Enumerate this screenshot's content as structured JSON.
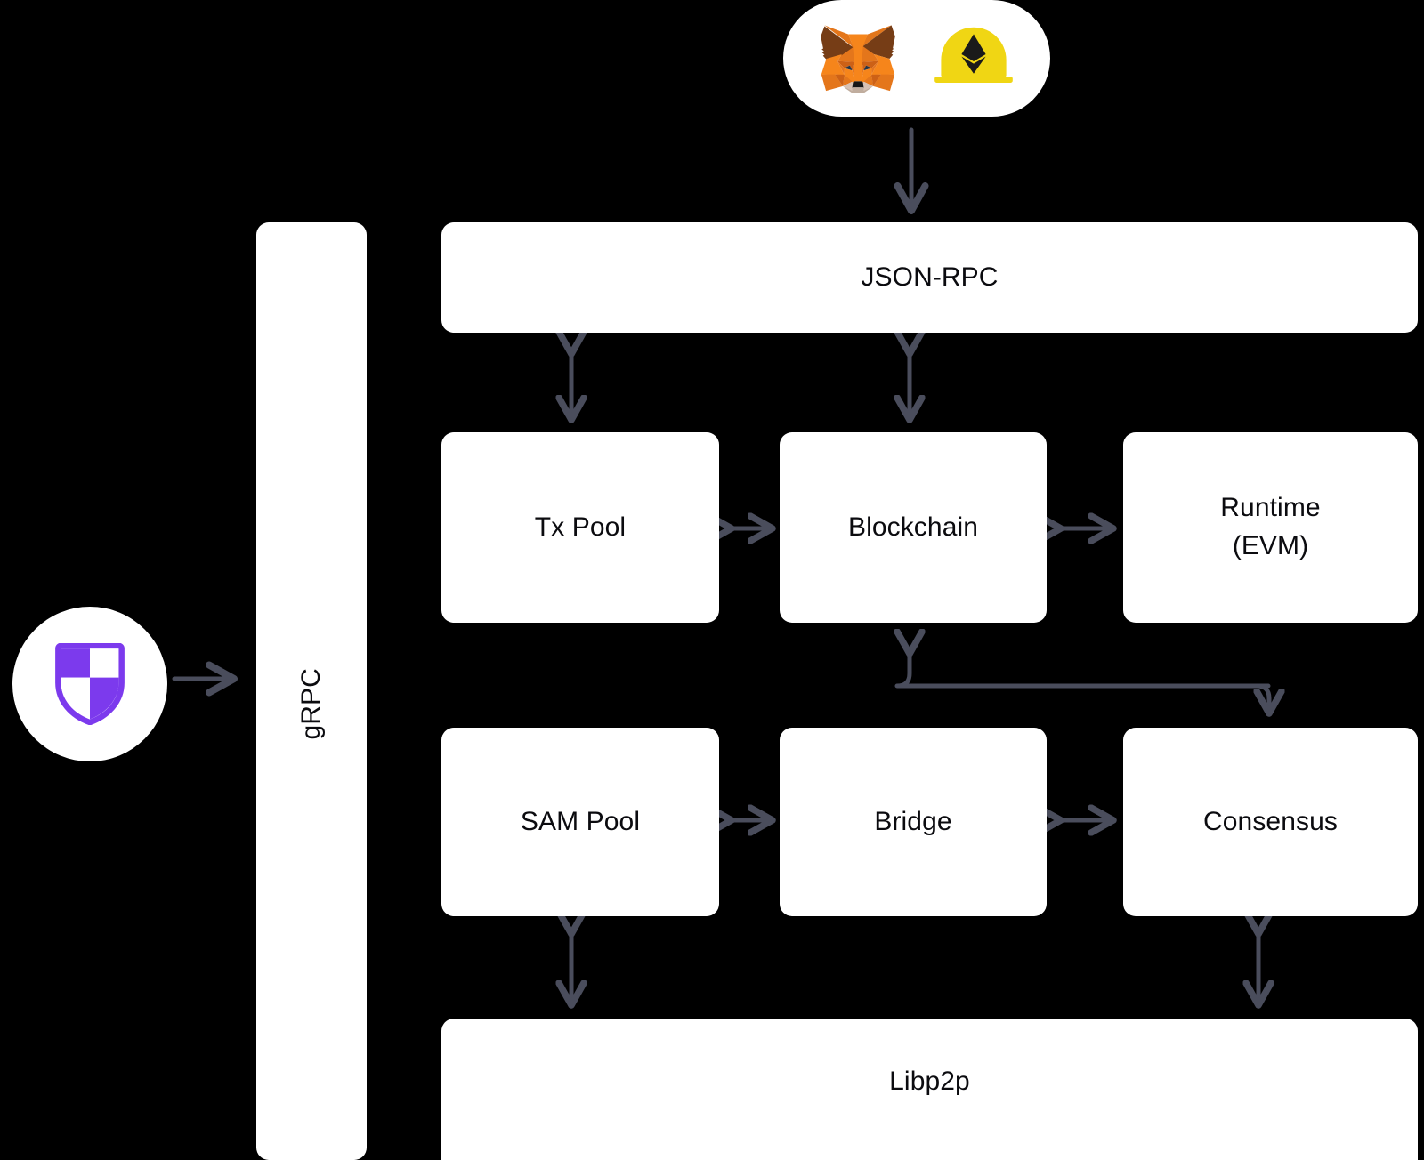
{
  "diagram": {
    "title": "Polygon Edge node architecture",
    "background_color": "#000000",
    "node_fill": "#ffffff",
    "node_text_color": "#0b0b0f",
    "arrow_color": "#4a4d5c",
    "accent_color": "#7c3aed"
  },
  "clients": {
    "name": "client-pill",
    "logos": [
      {
        "id": "metamask-logo",
        "label": "MetaMask",
        "color": "#e2761b"
      },
      {
        "id": "hardhat-logo",
        "label": "Hardhat",
        "color": "#f0d614"
      }
    ]
  },
  "edge_badge": {
    "name": "polygon-edge-shield",
    "label": "Polygon Edge",
    "color": "#7c3aed"
  },
  "nodes": {
    "grpc": "gRPC",
    "json_rpc": "JSON-RPC",
    "tx_pool": "Tx Pool",
    "blockchain": "Blockchain",
    "runtime_line1": "Runtime",
    "runtime_line2": "(EVM)",
    "sam_pool": "SAM Pool",
    "bridge": "Bridge",
    "consensus": "Consensus",
    "libp2p": "Libp2p"
  },
  "connections": [
    {
      "from": "clients",
      "to": "json_rpc",
      "kind": "single-down"
    },
    {
      "from": "edge_badge",
      "to": "grpc",
      "kind": "single-right"
    },
    {
      "from": "json_rpc",
      "to": "tx_pool",
      "kind": "bidirectional-vertical"
    },
    {
      "from": "json_rpc",
      "to": "blockchain",
      "kind": "bidirectional-vertical"
    },
    {
      "from": "tx_pool",
      "to": "blockchain",
      "kind": "bidirectional-horizontal"
    },
    {
      "from": "blockchain",
      "to": "runtime",
      "kind": "bidirectional-horizontal"
    },
    {
      "from": "consensus",
      "to": "blockchain",
      "kind": "elbow-bidirectional"
    },
    {
      "from": "sam_pool",
      "to": "bridge",
      "kind": "bidirectional-horizontal"
    },
    {
      "from": "bridge",
      "to": "consensus",
      "kind": "bidirectional-horizontal"
    },
    {
      "from": "sam_pool",
      "to": "libp2p",
      "kind": "bidirectional-vertical"
    },
    {
      "from": "consensus",
      "to": "libp2p",
      "kind": "bidirectional-vertical"
    }
  ]
}
